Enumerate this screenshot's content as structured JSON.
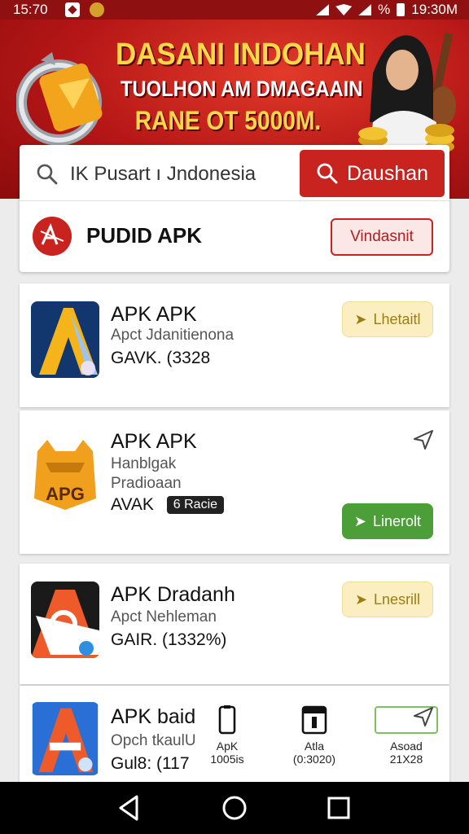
{
  "status_bar": {
    "time_left": "15:70",
    "battery": "%",
    "time_right": "19:30M"
  },
  "banner": {
    "line1": "DASANI INDOHAN",
    "line2": "TUOLHON AM DMAGAAIN",
    "line3": "RANE OT 5000M."
  },
  "search": {
    "value": "IK Pusart ı Jndonesia",
    "button_label": "Daushan"
  },
  "featured": {
    "title": "PUDID APK",
    "button_label": "Vindasnit"
  },
  "apps": [
    {
      "name": "APK APK",
      "subtitle": "Apct Jdanitienona",
      "meta": "GAVK. (3328",
      "button_label": "Lhetaitl"
    },
    {
      "name": "APK APK",
      "subtitle_line1": "Hanblgak",
      "subtitle_line2": "Pradioaan",
      "meta": "AVAK",
      "badge": "6 Racie",
      "icon_text": "APG",
      "button_label": "Linerolt"
    },
    {
      "name": "APK Dradanh",
      "subtitle": "Apct Nehleman",
      "meta": "GAIR. (1332%)",
      "button_label": "Lnesrill"
    },
    {
      "name": "APK baid",
      "subtitle": "Opch tkaulU",
      "meta": "Gul8: (117"
    }
  ],
  "stats": [
    {
      "line1": "ApK",
      "line2": "1005is"
    },
    {
      "line1": "Atla",
      "line2": "(0:3020)"
    },
    {
      "line1": "Asoad",
      "line2": "21X28"
    }
  ],
  "colors": {
    "brand_red": "#c8231f",
    "install_yellow": "#fbefc2",
    "install_green": "#4c9f38"
  }
}
